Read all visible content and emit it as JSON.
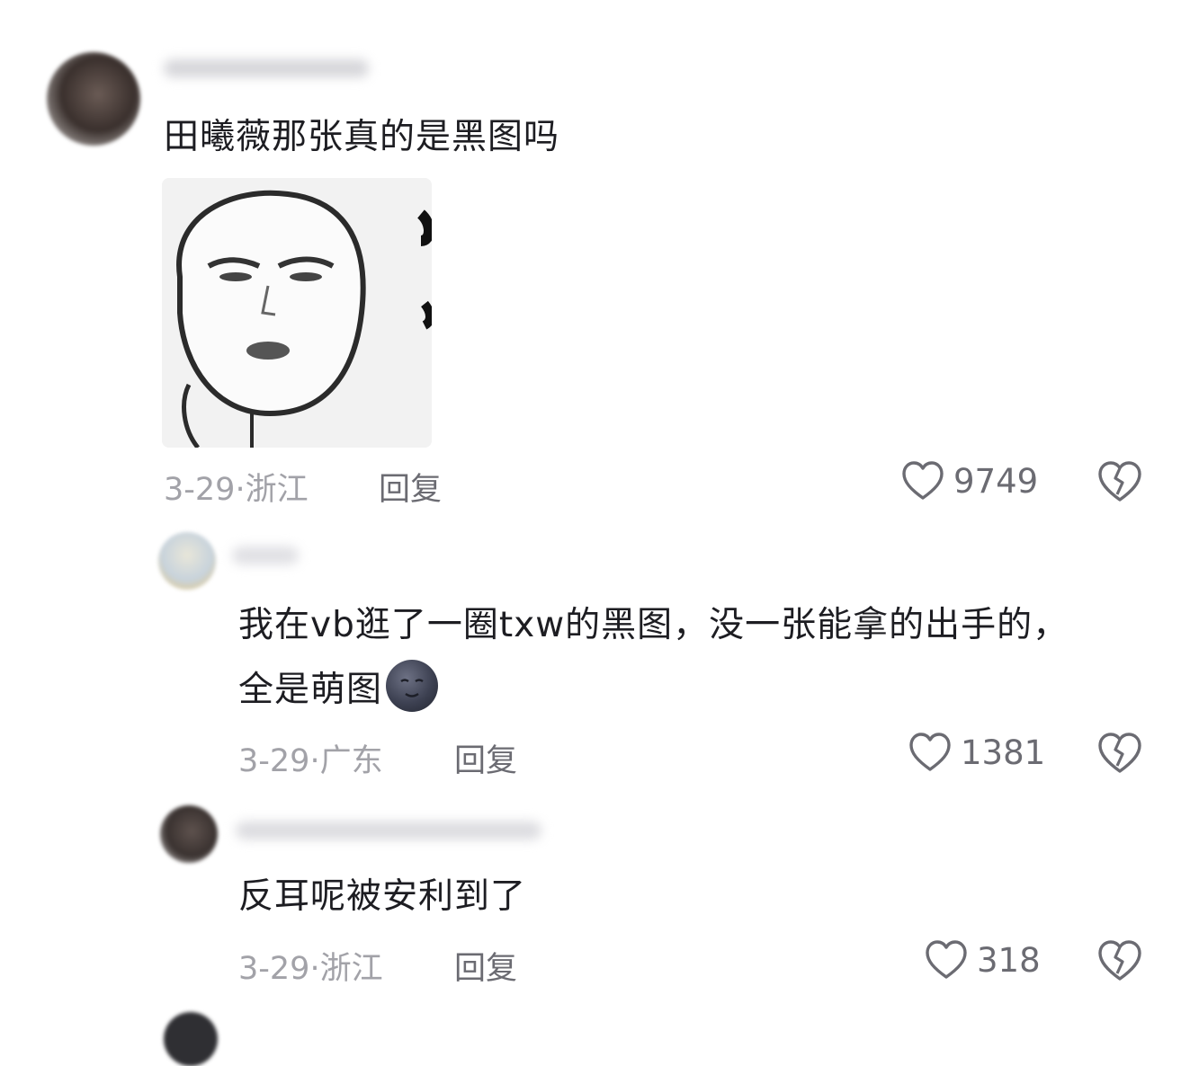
{
  "comments": [
    {
      "text": "田曦薇那张真的是黑图吗",
      "date": "3-29",
      "sep": "·",
      "location": "浙江",
      "reply_label": "回复",
      "likes": "9749"
    },
    {
      "text_line1": "我在vb逛了一圈txw的黑图，没一张能拿的出手的，",
      "text_line2": "全是萌图",
      "emoji": "new-moon-face",
      "date": "3-29",
      "sep": "·",
      "location": "广东",
      "reply_label": "回复",
      "likes": "1381"
    },
    {
      "text": "反耳呢被安利到了",
      "date": "3-29",
      "sep": "·",
      "location": "浙江",
      "reply_label": "回复",
      "likes": "318"
    }
  ],
  "colors": {
    "text": "#1d1d22",
    "meta": "#a2a2a8",
    "action": "#6b6b72",
    "background": "#ffffff"
  },
  "icons": [
    "heart-outline-icon",
    "broken-heart-icon",
    "new-moon-face-emoji"
  ]
}
